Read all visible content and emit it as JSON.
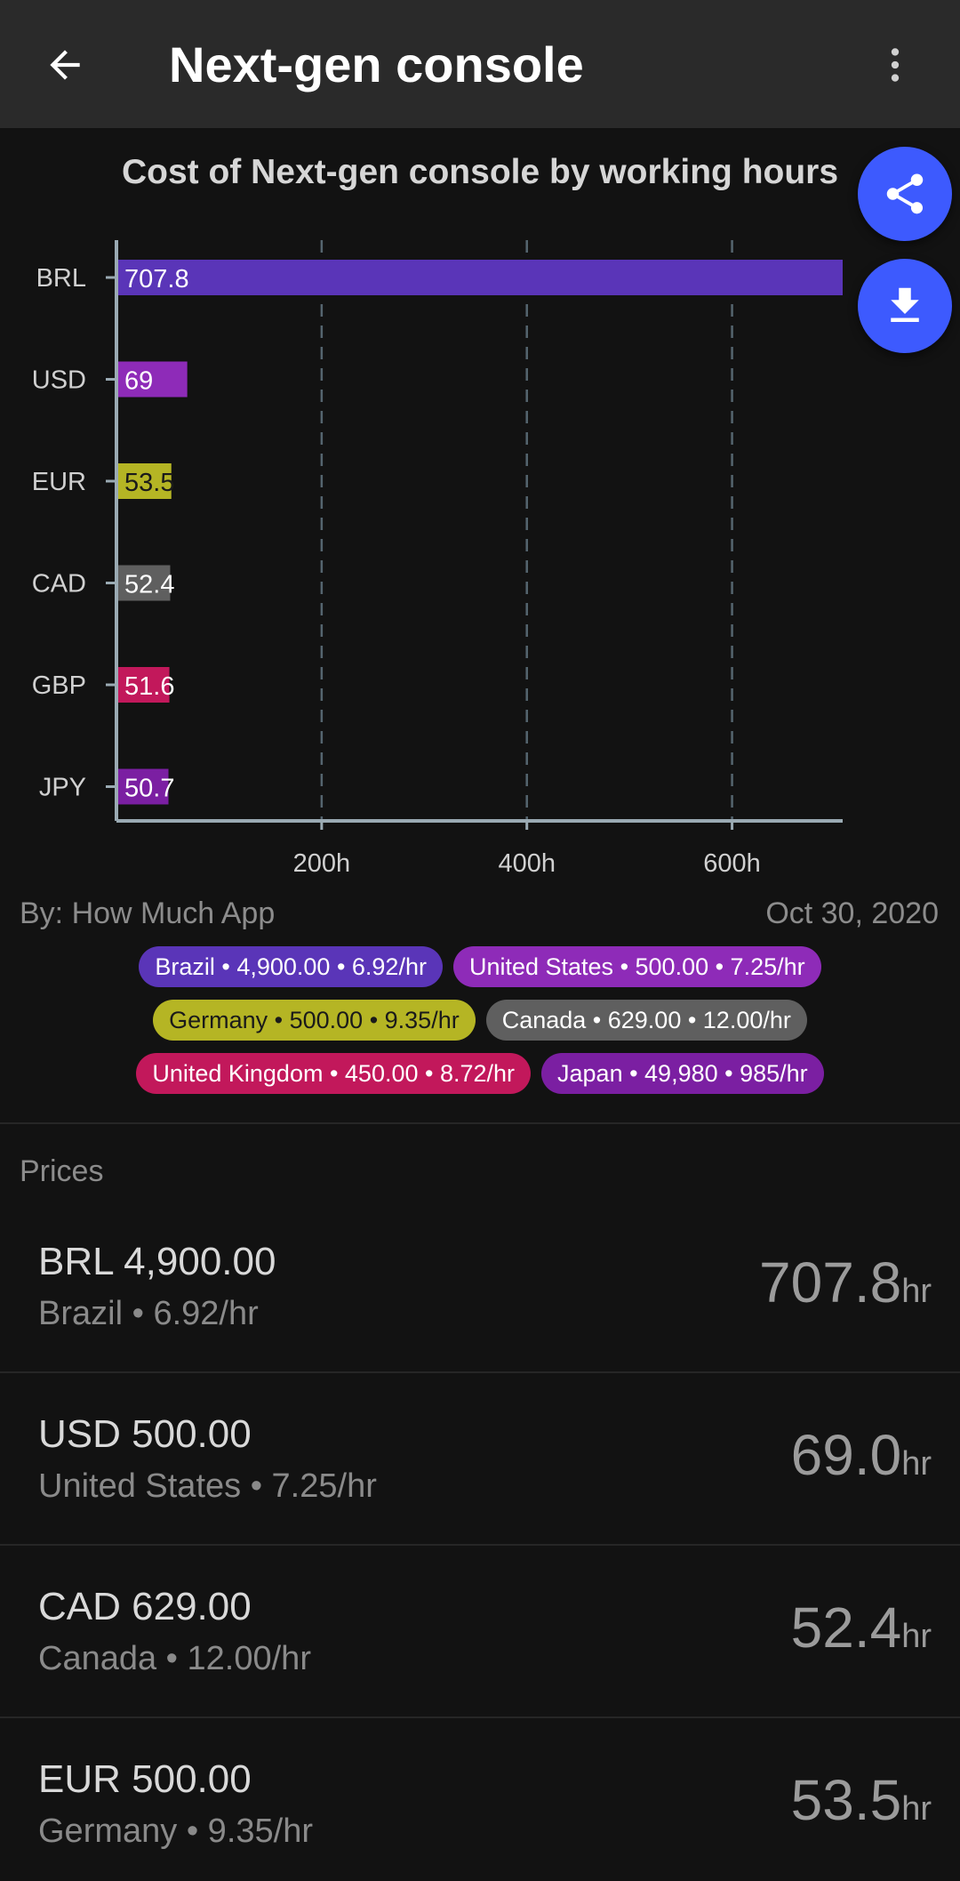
{
  "appbar": {
    "title": "Next-gen console"
  },
  "chart_data": {
    "type": "bar",
    "orientation": "horizontal",
    "title": "Cost of Next-gen console by working hours",
    "categories": [
      "BRL",
      "USD",
      "EUR",
      "CAD",
      "GBP",
      "JPY"
    ],
    "values": [
      707.8,
      69,
      53.5,
      52.4,
      51.6,
      50.7
    ],
    "value_labels": [
      "707.8",
      "69",
      "53.5",
      "52.4",
      "51.6",
      "50.7"
    ],
    "colors": [
      "#5a35b8",
      "#8e2bb8",
      "#b5b524",
      "#5f5f5f",
      "#c2185b",
      "#7b1fa2"
    ],
    "x_ticks": [
      200,
      400,
      600
    ],
    "x_tick_labels": [
      "200h",
      "400h",
      "600h"
    ],
    "xlim": [
      0,
      707.8
    ],
    "grid": "vertical dashed"
  },
  "meta": {
    "source": "By: How Much App",
    "date": "Oct 30, 2020"
  },
  "legend": {
    "rows": [
      [
        {
          "label": "Brazil • 4,900.00 • 6.92/hr",
          "color": "#5a35b8"
        },
        {
          "label": "United States • 500.00 • 7.25/hr",
          "color": "#8e2bb8"
        }
      ],
      [
        {
          "label": "Germany • 500.00 • 9.35/hr",
          "color": "#b5b524",
          "text_color": "#1a1a1a"
        },
        {
          "label": "Canada • 629.00 • 12.00/hr",
          "color": "#5f5f5f"
        }
      ],
      [
        {
          "label": "United Kingdom • 450.00 • 8.72/hr",
          "color": "#c2185b"
        },
        {
          "label": "Japan • 49,980 • 985/hr",
          "color": "#7b1fa2"
        }
      ]
    ]
  },
  "prices": {
    "section_label": "Prices",
    "items": [
      {
        "main": "BRL 4,900.00",
        "sub": "Brazil • 6.92/hr",
        "hours": "707.8",
        "unit": "hr"
      },
      {
        "main": "USD 500.00",
        "sub": "United States • 7.25/hr",
        "hours": "69.0",
        "unit": "hr"
      },
      {
        "main": "CAD 629.00",
        "sub": "Canada • 12.00/hr",
        "hours": "52.4",
        "unit": "hr"
      },
      {
        "main": "EUR 500.00",
        "sub": "Germany • 9.35/hr",
        "hours": "53.5",
        "unit": "hr"
      }
    ]
  },
  "icons": {
    "back": "arrow-back-icon",
    "menu": "more-vert-icon",
    "share": "share-icon",
    "download": "download-icon"
  }
}
